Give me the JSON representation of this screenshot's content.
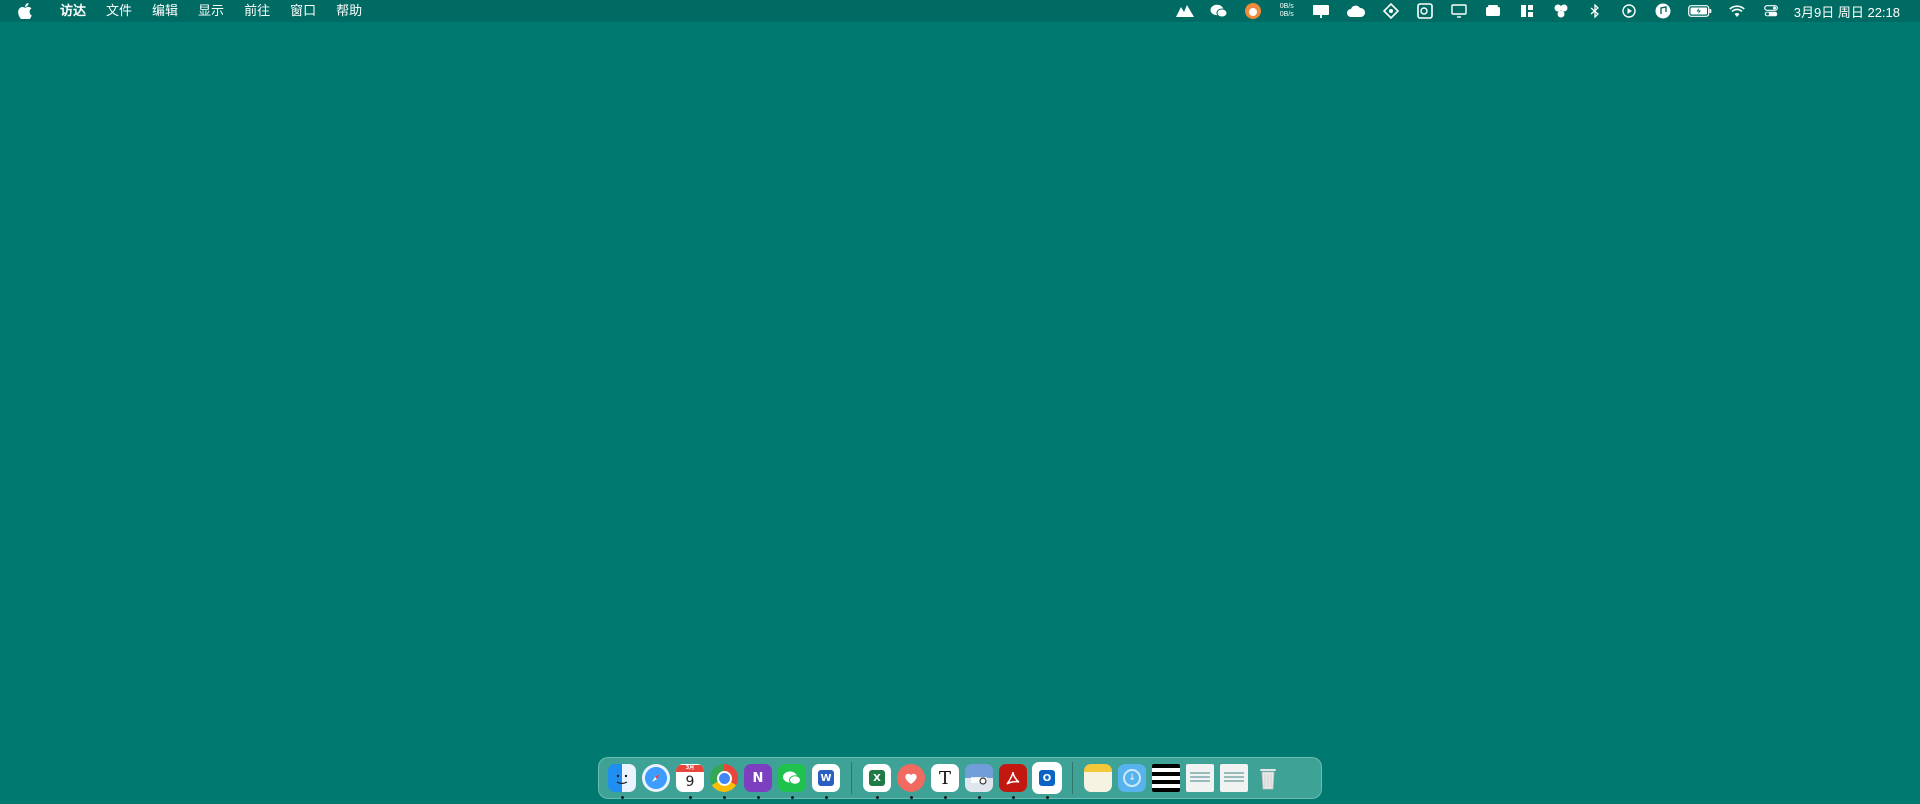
{
  "menubar": {
    "apple_icon": "apple-icon",
    "app_name": "访达",
    "menus": [
      "文件",
      "编辑",
      "显示",
      "前往",
      "窗口",
      "帮助"
    ],
    "network_speed": {
      "up": "0B/s",
      "down": "0B/s"
    },
    "status_icons": [
      "peaks-icon",
      "wechat-icon",
      "cat-icon",
      "network-speed",
      "display-icon",
      "cloud-icon",
      "satellite-icon",
      "outlook-icon",
      "screen-icon",
      "stack-icon",
      "layout-icon",
      "lark-icon",
      "bluetooth-icon",
      "play-icon",
      "music-icon",
      "battery-icon",
      "wifi-icon",
      "control-center-icon"
    ],
    "clock": "3月9日 周日  22:18"
  },
  "dock": {
    "apps": [
      {
        "name": "finder",
        "running": true
      },
      {
        "name": "safari",
        "running": false
      },
      {
        "name": "calendar",
        "running": true,
        "month": "3月",
        "day": "9"
      },
      {
        "name": "chrome",
        "running": true
      },
      {
        "name": "onenote",
        "running": true,
        "letter": "N"
      },
      {
        "name": "wechat",
        "running": true
      },
      {
        "name": "word",
        "running": true,
        "letter": "W"
      },
      {
        "name": "excel",
        "running": true,
        "letter": "X"
      },
      {
        "name": "lark",
        "running": true
      },
      {
        "name": "typora",
        "running": true,
        "letter": "T"
      },
      {
        "name": "preview",
        "running": true
      },
      {
        "name": "acrobat",
        "running": true
      },
      {
        "name": "outlook",
        "running": true,
        "letter": "O"
      }
    ],
    "recent": [
      "notes"
    ],
    "stacks": [
      "downloads-folder",
      "thumbnail-1",
      "thumbnail-2",
      "thumbnail-3",
      "trash"
    ]
  },
  "colors": {
    "desktop": "#007a70",
    "menubar": "#006b62"
  }
}
